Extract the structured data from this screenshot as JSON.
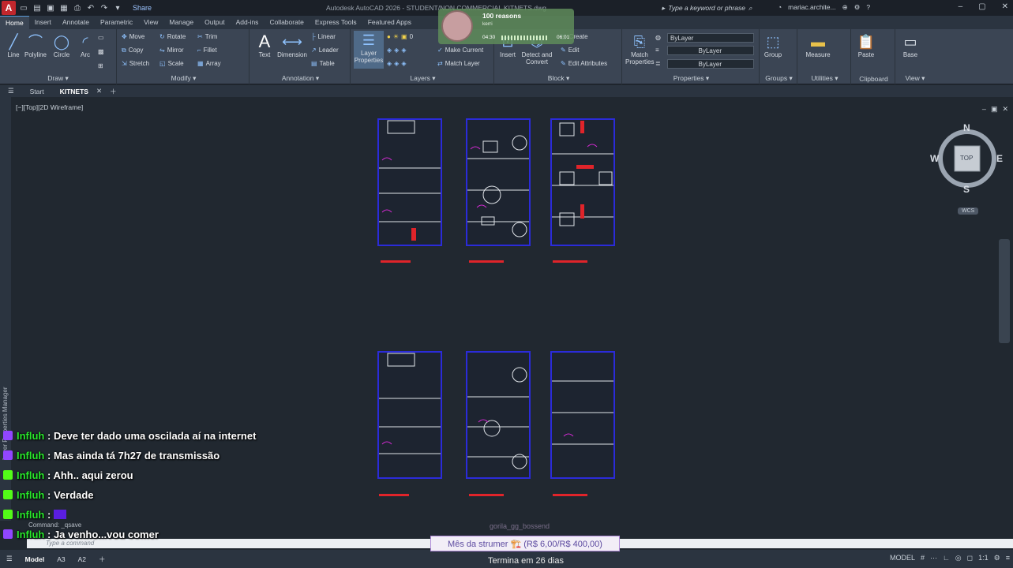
{
  "titlebar": {
    "app_icon": "A",
    "share_label": "Share",
    "title": "Autodesk AutoCAD 2026 - STUDENT/NON COMMERCIAL   KITNETS.dwg",
    "search_placeholder": "Type a keyword or phrase",
    "user": "mariac.archite..."
  },
  "ribbon_tabs": [
    "Home",
    "Insert",
    "Annotate",
    "Parametric",
    "View",
    "Manage",
    "Output",
    "Add-ins",
    "Collaborate",
    "Express Tools",
    "Featured Apps"
  ],
  "ribbon": {
    "draw": {
      "title": "Draw",
      "tools": [
        "Line",
        "Polyline",
        "Circle",
        "Arc"
      ]
    },
    "modify": {
      "title": "Modify",
      "items": [
        "Move",
        "Rotate",
        "Trim",
        "Copy",
        "Mirror",
        "Fillet",
        "Stretch",
        "Scale",
        "Array"
      ]
    },
    "annotation": {
      "title": "Annotation",
      "text": "Text",
      "dimension": "Dimension",
      "items": [
        "Linear",
        "Leader",
        "Table"
      ]
    },
    "layers": {
      "title": "Layers",
      "layer_properties": "Layer Properties",
      "make_current": "Make Current",
      "match_layer": "Match Layer",
      "current_layer": "0"
    },
    "block": {
      "title": "Block",
      "insert": "Insert",
      "detect": "Detect and Convert",
      "items": [
        "Create",
        "Edit",
        "Edit Attributes"
      ]
    },
    "properties": {
      "title": "Properties",
      "match": "Match Properties",
      "bylayer": [
        "ByLayer",
        "ByLayer",
        "ByLayer"
      ]
    },
    "groups": {
      "title": "Groups",
      "group": "Group"
    },
    "utilities": {
      "title": "Utilities",
      "measure": "Measure"
    },
    "clipboard": {
      "title": "Clipboard",
      "paste": "Paste"
    },
    "view": {
      "title": "View",
      "base": "Base"
    }
  },
  "doc_tabs": {
    "start": "Start",
    "file": "KITNETS"
  },
  "viewport": {
    "label": "[−][Top][2D Wireframe]",
    "side_panel": "Layer Properties Manager",
    "viewcube": {
      "n": "N",
      "s": "S",
      "e": "E",
      "w": "W",
      "top": "TOP",
      "wcs": "WCS"
    }
  },
  "music": {
    "title": "100 reasons",
    "artist": "kerri",
    "elapsed": "04:30",
    "total": "06:01"
  },
  "chat": [
    {
      "user": "Influh",
      "sep": " : ",
      "text": "Deve ter dado uma oscilada aí na internet",
      "badge": "twitch"
    },
    {
      "user": "Influh",
      "sep": " : ",
      "text": "Mas ainda tá 7h27 de transmissão",
      "badge": "twitch"
    },
    {
      "user": "Influh",
      "sep": " : ",
      "text": "Ahh.. aqui zerou",
      "badge": "kick"
    },
    {
      "user": "Influh",
      "sep": " : ",
      "text": "Verdade",
      "badge": "kick"
    },
    {
      "user": "Influh",
      "sep": " : ",
      "text": "",
      "badge": "kick"
    },
    {
      "user": "Influh",
      "sep": " : ",
      "text": "Ja venho...vou comer",
      "badge": "twitch"
    }
  ],
  "command": {
    "history": "Command: _qsave",
    "placeholder": "Type a command"
  },
  "donation": {
    "name": "gorila_gg_bossend",
    "label": "Mês da strumer 🏗️ (R$ 6,00/R$ 400,00)",
    "ends": "Termina em 26 dias"
  },
  "status": {
    "layouts": [
      "Model",
      "A3",
      "A2"
    ],
    "mode": "MODEL",
    "scale": "1:1"
  },
  "colors": {
    "accent": "#5a9bd8",
    "plan_border": "#2b2bd9",
    "red": "#e0242a",
    "chat_name": "#29e82c",
    "twitch": "#9146ff",
    "kick": "#53fc18"
  }
}
